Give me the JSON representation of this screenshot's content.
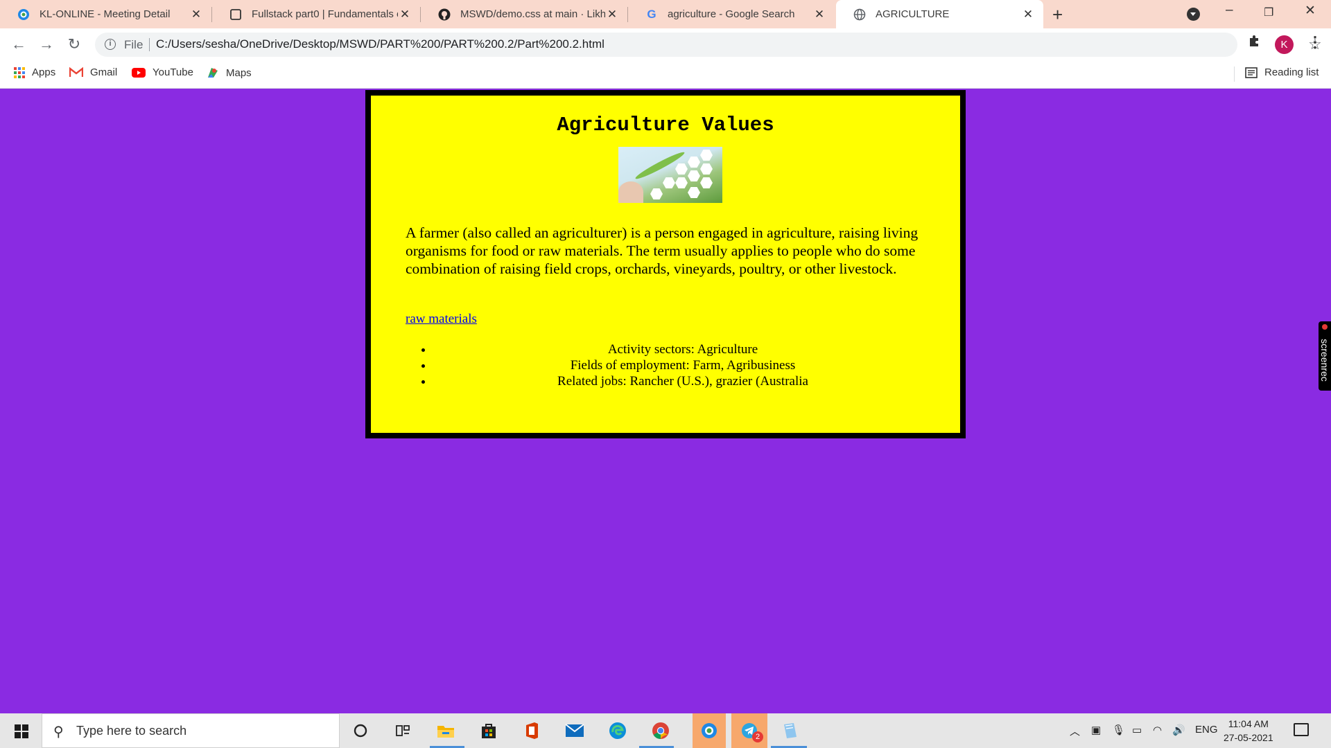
{
  "browser": {
    "tabs": [
      {
        "title": "KL-ONLINE - Meeting Detail",
        "icon": "kl-online-icon"
      },
      {
        "title": "Fullstack part0 | Fundamentals of",
        "icon": "fullstack-icon"
      },
      {
        "title": "MSWD/demo.css at main · Likhith",
        "icon": "github-icon"
      },
      {
        "title": "agriculture - Google Search",
        "icon": "google-icon"
      },
      {
        "title": "AGRICULTURE",
        "icon": "globe-icon"
      }
    ],
    "active_tab": 4,
    "address": {
      "scheme_label": "File",
      "url": "C:/Users/sesha/OneDrive/Desktop/MSWD/PART%200/PART%200.2/Part%200.2.html"
    },
    "profile_initial": "K",
    "bookmarks": [
      {
        "label": "Apps",
        "icon": "apps-grid-icon"
      },
      {
        "label": "Gmail",
        "icon": "gmail-icon"
      },
      {
        "label": "YouTube",
        "icon": "youtube-icon"
      },
      {
        "label": "Maps",
        "icon": "maps-icon"
      }
    ],
    "reading_list_label": "Reading list"
  },
  "page": {
    "heading": "Agriculture Values",
    "paragraph": "A farmer (also called an agriculturer) is a person engaged in agriculture, raising living organisms for food or raw materials. The term usually applies to people who do some combination of raising field crops, orchards, vineyards, poultry, or other livestock.",
    "link_text": "raw materials",
    "list_items": [
      "Activity sectors: Agriculture",
      "Fields of employment: Farm, Agribusiness",
      "Related jobs: Rancher (U.S.), grazier (Australia"
    ],
    "colors": {
      "background": "#8a2be2",
      "card": "#ffff00",
      "border": "#000000"
    }
  },
  "watermark": {
    "brand": "screenrec"
  },
  "taskbar": {
    "search_placeholder": "Type here to search",
    "telegram_badge": "2",
    "language": "ENG",
    "time": "11:04 AM",
    "date": "27-05-2021"
  }
}
